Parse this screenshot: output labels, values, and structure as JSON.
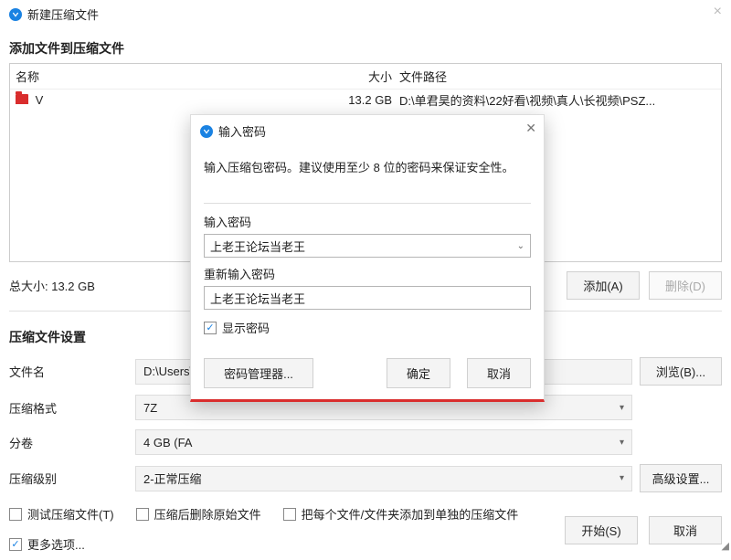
{
  "window": {
    "title": "新建压缩文件"
  },
  "section_add": {
    "title": "添加文件到压缩文件",
    "columns": {
      "name": "名称",
      "size": "大小",
      "path": "文件路径"
    },
    "rows": [
      {
        "name": "V",
        "size": "13.2 GB",
        "path": "D:\\单君昊的资料\\22好看\\视频\\真人\\长视频\\PSZ..."
      }
    ],
    "total_label": "总大小: 13.2 GB",
    "add_btn": "添加(A)",
    "del_btn": "删除(D)"
  },
  "section_settings": {
    "title": "压缩文件设置",
    "filename_label": "文件名",
    "filename_value": "D:\\Users\\",
    "browse_btn": "浏览(B)...",
    "format_label": "压缩格式",
    "format_value": "7Z",
    "split_label": "分卷",
    "split_value": "4 GB (FA",
    "level_label": "压缩级别",
    "level_value": "2-正常压缩",
    "advanced_btn": "高级设置...",
    "test_chk": "测试压缩文件(T)",
    "del_orig_chk": "压缩后删除原始文件",
    "each_sep_chk": "把每个文件/文件夹添加到单独的压缩文件",
    "more_chk": "更多选项..."
  },
  "footer": {
    "start_btn": "开始(S)",
    "cancel_btn": "取消"
  },
  "modal": {
    "title": "输入密码",
    "hint": "输入压缩包密码。建议使用至少 8 位的密码来保证安全性。",
    "pwd_label": "输入密码",
    "pwd_value": "上老王论坛当老王",
    "re_label": "重新输入密码",
    "re_value": "上老王论坛当老王",
    "show_chk": "显示密码",
    "pwd_mgr_btn": "密码管理器...",
    "ok_btn": "确定",
    "cancel_btn": "取消"
  }
}
